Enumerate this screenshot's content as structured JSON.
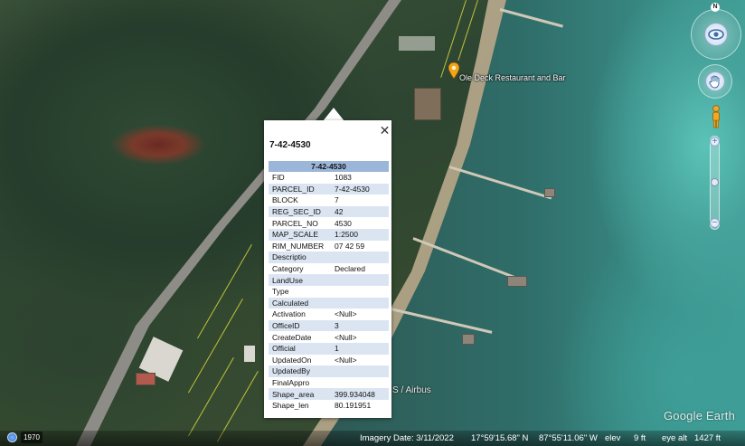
{
  "map": {
    "placemark_label": "Ole Deck Restaurant and Bar",
    "imagery_attribution": "S / Airbus"
  },
  "popup": {
    "title": "7-42-4530",
    "table_header": "7-42-4530",
    "rows": [
      {
        "key": "FID",
        "value": "1083"
      },
      {
        "key": "PARCEL_ID",
        "value": "7-42-4530"
      },
      {
        "key": "BLOCK",
        "value": "7"
      },
      {
        "key": "REG_SEC_ID",
        "value": "42"
      },
      {
        "key": "PARCEL_NO",
        "value": "4530"
      },
      {
        "key": "MAP_SCALE",
        "value": "1:2500"
      },
      {
        "key": "RIM_NUMBER",
        "value": "07 42 59"
      },
      {
        "key": "Descriptio",
        "value": ""
      },
      {
        "key": "Category",
        "value": "Declared"
      },
      {
        "key": "LandUse",
        "value": ""
      },
      {
        "key": "Type",
        "value": ""
      },
      {
        "key": "Calculated",
        "value": ""
      },
      {
        "key": "Activation",
        "value": "<Null>"
      },
      {
        "key": "OfficeID",
        "value": "3"
      },
      {
        "key": "CreateDate",
        "value": "<Null>"
      },
      {
        "key": "Official",
        "value": "1"
      },
      {
        "key": "UpdatedOn",
        "value": "<Null>"
      },
      {
        "key": "UpdatedBy",
        "value": ""
      },
      {
        "key": "FinalAppro",
        "value": ""
      },
      {
        "key": "Shape_area",
        "value": "399.934048"
      },
      {
        "key": "Shape_len",
        "value": "80.191951"
      }
    ]
  },
  "controls": {
    "north_label": "N",
    "zoom_in": "+",
    "zoom_out": "−",
    "zoom_level_fraction": 0.5
  },
  "statusbar": {
    "history_year": "1970",
    "imagery_date": "Imagery Date: 3/11/2022",
    "latitude": "17°59'15.68\" N",
    "longitude": "87°55'11.06\" W",
    "elev_label": "elev",
    "elev_value": "9 ft",
    "eye_alt": "eye alt",
    "eye_alt_value": "1427 ft"
  },
  "branding": {
    "logo_text": "Google Earth"
  },
  "colors": {
    "table_header_bg": "#9cb6da",
    "table_alt_row_bg": "#dbe5f2",
    "parcel_line": "#e6e23a"
  }
}
